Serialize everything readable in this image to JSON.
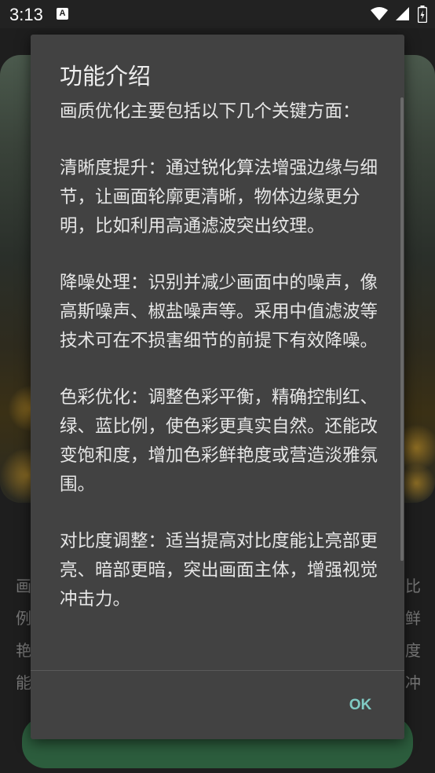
{
  "status_bar": {
    "time": "3:13",
    "notification_icon_letter": "A",
    "icons": [
      "wifi-icon",
      "signal-icon",
      "battery-icon"
    ]
  },
  "background": {
    "text_left": [
      "画",
      "例",
      "艳",
      "能"
    ],
    "text_right": [
      "比",
      "鲜",
      "度",
      "冲"
    ],
    "button_color": "#2c5d3d"
  },
  "dialog": {
    "title": "功能介绍",
    "paragraphs": [
      "画质优化主要包括以下几个关键方面：",
      "清晰度提升：通过锐化算法增强边缘与细节，让画面轮廓更清晰，物体边缘更分明，比如利用高通滤波突出纹理。",
      "降噪处理：识别并减少画面中的噪声，像高斯噪声、椒盐噪声等。采用中值滤波等技术可在不损害细节的前提下有效降噪。",
      "色彩优化：调整色彩平衡，精确控制红、绿、蓝比例，使色彩更真实自然。还能改变饱和度，增加色彩鲜艳度或营造淡雅氛围。",
      "对比度调整：适当提高对比度能让亮部更亮、暗部更暗，突出画面主体，增强视觉冲击力。"
    ],
    "ok_label": "OK",
    "accent_color": "#80cbc4"
  }
}
